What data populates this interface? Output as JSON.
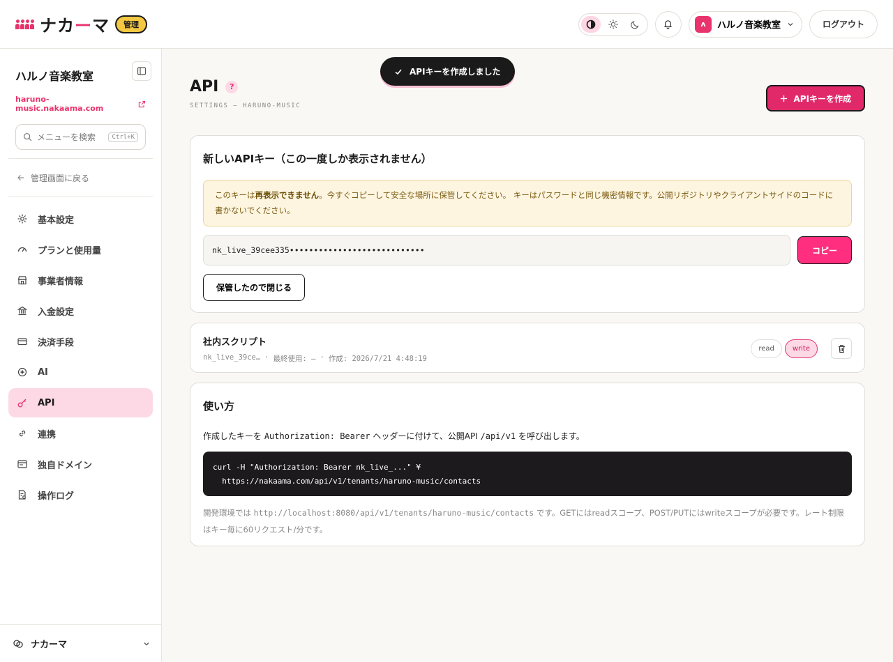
{
  "brand": {
    "name_pre": "ナカ",
    "name_dash": "ー",
    "name_post": "マ",
    "admin_badge": "管理",
    "accent": "#e8336d"
  },
  "topbar": {
    "tenant_avatar": "ʌ",
    "tenant_name": "ハルノ音楽教室",
    "logout": "ログアウト"
  },
  "sidebar": {
    "title": "ハルノ音楽教室",
    "domain": "haruno-music.nakaama.com",
    "search_placeholder": "メニューを検索",
    "search_shortcut": "Ctrl+K",
    "back": "管理画面に戻る",
    "items": [
      {
        "label": "基本設定",
        "icon": "gear-icon"
      },
      {
        "label": "プランと使用量",
        "icon": "gauge-icon"
      },
      {
        "label": "事業者情報",
        "icon": "store-icon"
      },
      {
        "label": "入金設定",
        "icon": "bank-icon"
      },
      {
        "label": "決済手段",
        "icon": "credit-card-icon"
      },
      {
        "label": "AI",
        "icon": "ai-icon"
      },
      {
        "label": "API",
        "icon": "key-icon"
      },
      {
        "label": "連携",
        "icon": "link-icon"
      },
      {
        "label": "独自ドメイン",
        "icon": "browser-icon"
      },
      {
        "label": "操作ログ",
        "icon": "log-file-icon"
      }
    ],
    "footer": "ナカーマ"
  },
  "toast": "APIキーを作成しました",
  "page": {
    "title": "API",
    "help": "?",
    "breadcrumb": "SETTINGS — HARUNO-MUSIC",
    "create_button": "APIキーを作成"
  },
  "new_key": {
    "heading": "新しいAPIキー（この一度しか表示されません）",
    "warn_pre": "このキーは",
    "warn_bold": "再表示できません",
    "warn_post": "。今すぐコピーして安全な場所に保管してください。 キーはパスワードと同じ機密情報です。公開リポジトリやクライアントサイドのコードに書かないでください。",
    "key_value": "nk_live_39cee335••••••••••••••••••••••••••••",
    "copy_button": "コピー",
    "close_button": "保管したので閉じる"
  },
  "keys": [
    {
      "name": "社内スクリプト",
      "prefix": "nk_live_39ce…",
      "last_used": "最終使用: —",
      "created": "作成: 2026/7/21 4:48:19",
      "scopes": [
        "read",
        "write"
      ]
    }
  ],
  "usage": {
    "heading": "使い方",
    "desc_pre": "作成したキーを ",
    "desc_code": "Authorization: Bearer",
    "desc_mid": " ヘッダーに付けて、公開API ",
    "desc_path": "/api/v1",
    "desc_post": " を呼び出します。",
    "code": "curl -H \"Authorization: Bearer nk_live_...\" ¥\n  https://nakaama.com/api/v1/tenants/haruno-music/contacts",
    "note_pre": "開発環境では ",
    "note_url": "http://localhost:8080/api/v1/tenants/haruno-music/contacts",
    "note_post": " です。GETにはreadスコープ、POST/PUTにはwriteスコープが必要です。レート制限はキー毎に60リクエスト/分です。"
  }
}
